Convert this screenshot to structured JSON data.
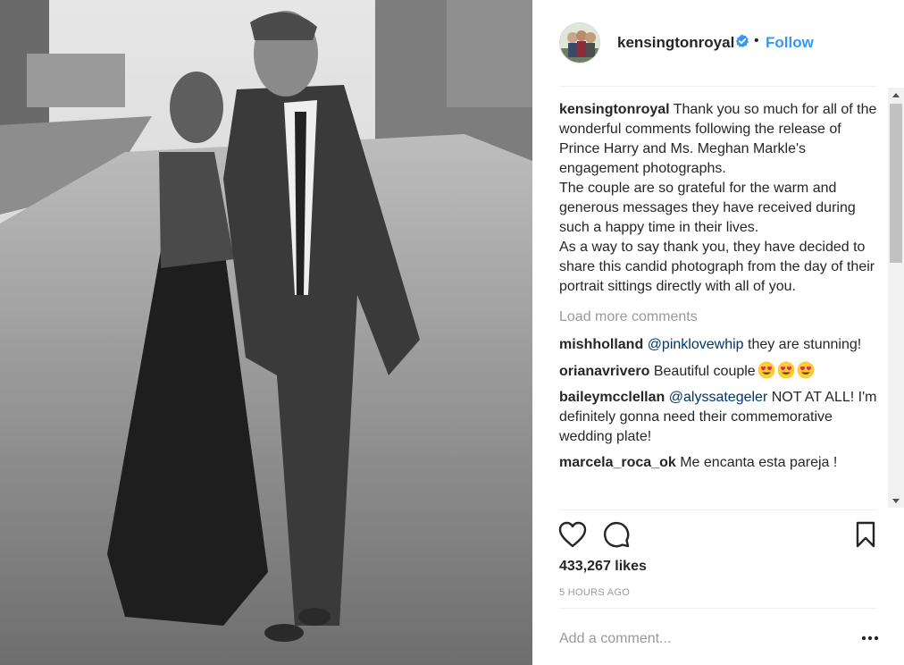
{
  "post": {
    "account": "kensingtonroyal",
    "follow_label": "Follow",
    "separator": "•",
    "caption": "Thank you so much for all of the wonderful comments following the release of Prince Harry and Ms. Meghan Markle's engagement photographs.\nThe couple are so grateful for the warm and generous messages they have received during such a happy time in their lives.\nAs a way to say thank you, they have decided to share this candid photograph from the day of their portrait sittings directly with all of you.",
    "load_more": "Load more comments",
    "comments": [
      {
        "user": "mishholland",
        "mention": "@pinklovewhip",
        "text": " they are stunning!"
      },
      {
        "user": "orianavrivero",
        "mention": "",
        "text": "Beautiful couple"
      },
      {
        "user": "baileymcclellan",
        "mention": "@alyssategeler",
        "text": " NOT AT ALL! I'm definitely gonna need their commemorative wedding plate!"
      },
      {
        "user": "marcela_roca_ok",
        "mention": "",
        "text": "Me encanta esta pareja !"
      }
    ],
    "likes": "433,267 likes",
    "time": "5 HOURS AGO",
    "add_comment_placeholder": "Add a comment..."
  },
  "icons": {
    "verified": "verified-badge-icon",
    "like": "heart-icon",
    "comment": "comment-bubble-icon",
    "save": "bookmark-icon",
    "more": "more-options-icon",
    "emoji": "heart-eyes-emoji-icon"
  },
  "colors": {
    "link_blue": "#3897f0",
    "mention_blue": "#003569",
    "muted_gray": "#999999",
    "text": "#262626",
    "divider": "#efefef"
  }
}
